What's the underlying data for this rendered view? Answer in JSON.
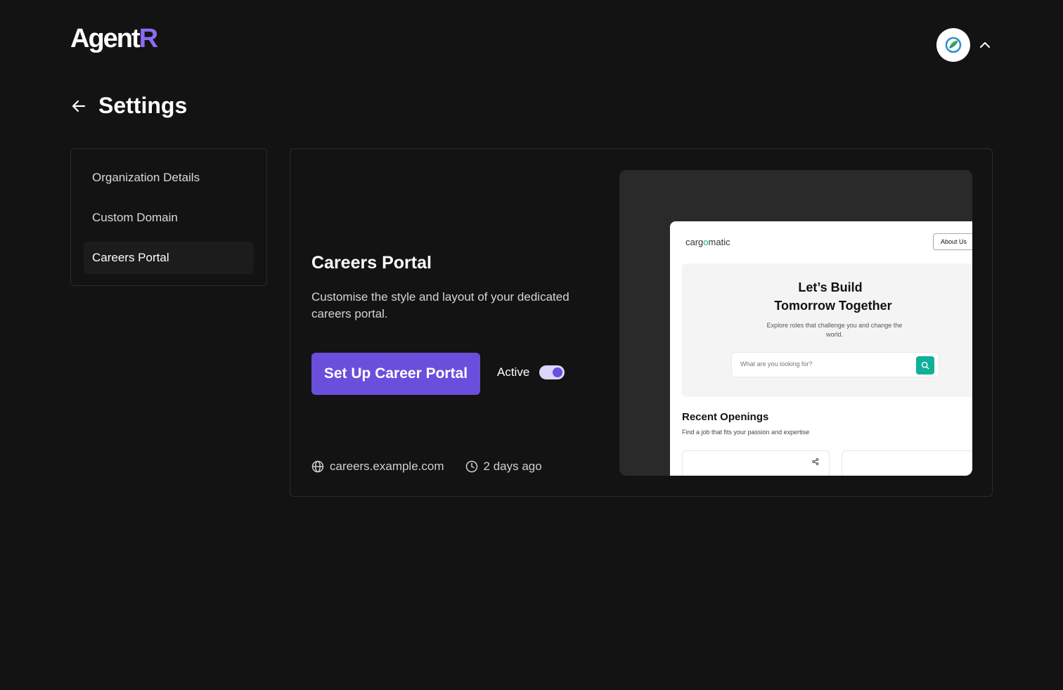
{
  "header": {
    "logo_main": "Agent",
    "logo_accent": "R",
    "avatar_icon": "leaf-globe-icon",
    "menu_icon": "chevron-up-icon"
  },
  "page": {
    "title": "Settings",
    "back_icon": "arrow-left-icon"
  },
  "sidebar": {
    "items": [
      {
        "label": "Organization Details",
        "active": false
      },
      {
        "label": "Custom Domain",
        "active": false
      },
      {
        "label": "Careers Portal",
        "active": true
      }
    ]
  },
  "careers_portal": {
    "title": "Careers Portal",
    "description": "Customise  the style and layout of your dedicated careers portal.",
    "cta_label": "Set Up Career Portal",
    "toggle_label": "Active",
    "toggle_on": true,
    "domain": "careers.example.com",
    "domain_icon": "globe-icon",
    "updated": "2 days ago",
    "updated_icon": "clock-icon"
  },
  "preview": {
    "brand_before": "carg",
    "brand_o": "o",
    "brand_after": "matic",
    "about_label": "About Us",
    "hero_line1": "Let’s Build",
    "hero_line2": "Tomorrow Together",
    "hero_sub": "Explore roles that challenge you and change the world.",
    "search_placeholder": "What are you looking for?",
    "search_icon": "search-icon",
    "recent_title": "Recent Openings",
    "recent_sub": "Find a job that fits your passion and expertise",
    "share_icon": "share-icon"
  },
  "colors": {
    "background": "#131313",
    "accent": "#6a4fdc",
    "logo_accent": "#8b6cf0",
    "preview_accent": "#11b097"
  }
}
